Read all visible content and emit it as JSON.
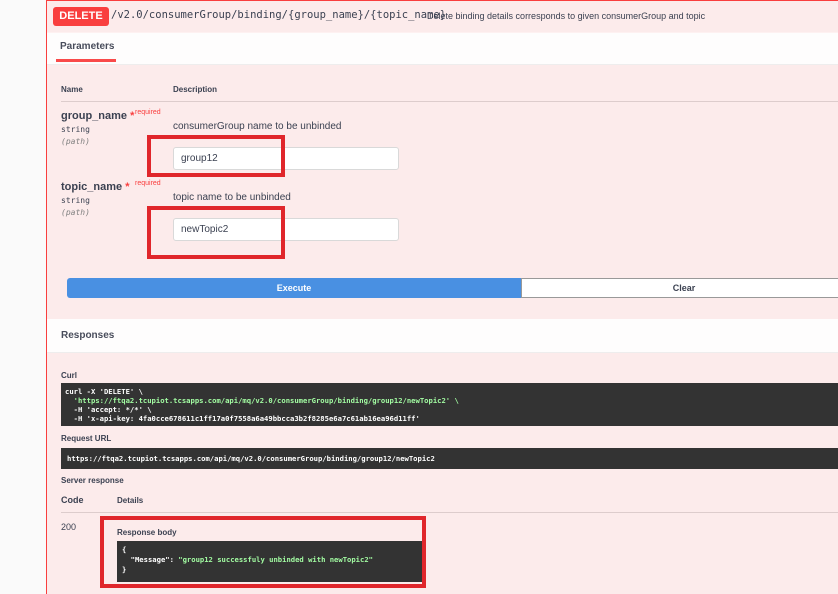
{
  "operation": {
    "method": "DELETE",
    "path": "/v2.0/consumerGroup/binding/{group_name}/{topic_name}",
    "description": "Delete binding details corresponds to given consumerGroup and topic"
  },
  "parameters": {
    "tab_label": "Parameters",
    "col_name": "Name",
    "col_description": "Description",
    "items": [
      {
        "name": "group_name",
        "star": "*",
        "required": "required",
        "type": "string",
        "in": "(path)",
        "description": "consumerGroup name to be unbinded",
        "value": "group12"
      },
      {
        "name": "topic_name",
        "star": "*",
        "required": "required",
        "type": "string",
        "in": "(path)",
        "description": "topic name to be unbinded",
        "value": "newTopic2"
      }
    ]
  },
  "buttons": {
    "execute": "Execute",
    "clear": "Clear"
  },
  "responses": {
    "title": "Responses",
    "curl_label": "Curl",
    "curl_lines": [
      "curl -X 'DELETE' \\",
      "  'https://ftqa2.tcupiot.tcsapps.com/api/mq/v2.0/consumerGroup/binding/group12/newTopic2' \\",
      "  -H 'accept: */*' \\",
      "  -H 'x-api-key: 4fa0cce678611c1ff17a0f7558a6a49bbcca3b2f8285e6a7c61ab16ea96d11ff'"
    ],
    "request_url_label": "Request URL",
    "request_url": "https://ftqa2.tcupiot.tcsapps.com/api/mq/v2.0/consumerGroup/binding/group12/newTopic2",
    "server_response_label": "Server response",
    "code_header": "Code",
    "details_header": "Details",
    "code": "200",
    "response_body_label": "Response body",
    "body_open": "{",
    "body_key": "  \"Message\": ",
    "body_value": "\"group12 successfuly unbinded with newTopic2\"",
    "body_close": "}"
  },
  "colors": {
    "delete": "#f93e3e",
    "execute": "#4990e2",
    "highlight": "#e0262b"
  }
}
